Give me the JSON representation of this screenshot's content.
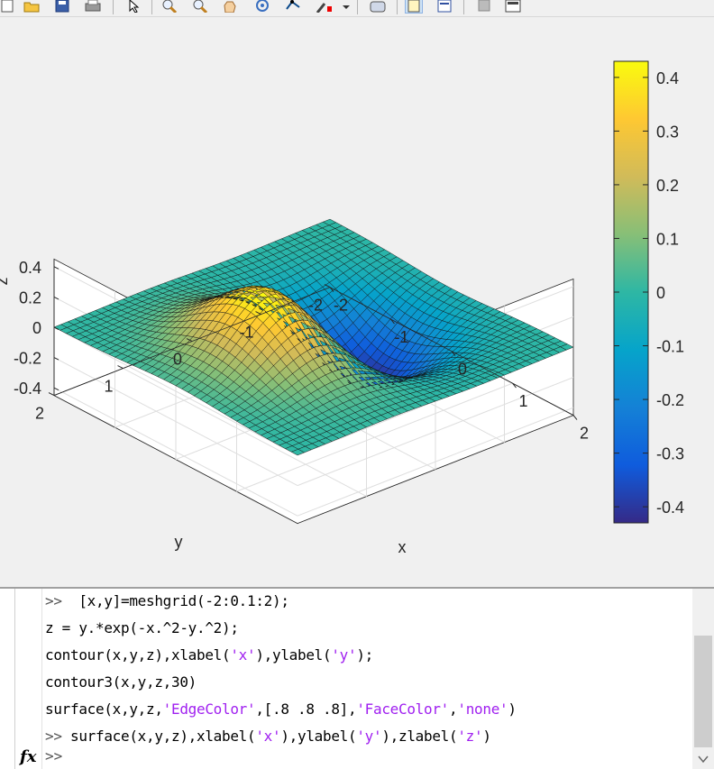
{
  "toolbar": {
    "buttons": [
      "new-figure-icon",
      "open-file-icon",
      "save-figure-icon",
      "print-figure-icon",
      "edit-plot-icon",
      "zoom-in-icon",
      "zoom-out-icon",
      "pan-icon",
      "rotate-3d-icon",
      "data-cursor-icon",
      "brush-icon",
      "link-plot-icon",
      "insert-colorbar-icon",
      "insert-legend-icon",
      "hide-plot-tools-icon",
      "show-plot-tools-icon"
    ]
  },
  "figure": {
    "zlabel": "z",
    "xlabel": "x",
    "ylabel": "y",
    "z_ticks": [
      "0.4",
      "0.2",
      "0",
      "-0.2",
      "-0.4"
    ],
    "x_ticks": [
      "-2",
      "-1",
      "0",
      "1",
      "2"
    ],
    "y_ticks": [
      "2",
      "1",
      "0",
      "-1",
      "-2"
    ],
    "colorbar_ticks": [
      "0.4",
      "0.3",
      "0.2",
      "0.1",
      "0",
      "-0.1",
      "-0.2",
      "-0.3",
      "-0.4"
    ],
    "colormap": "parula",
    "colors": {
      "low": "#352a87",
      "mid": "#21b1a4",
      "high": "#f9fb0e",
      "axes_bg": "#ffffff",
      "figure_bg": "#f0f0f0"
    }
  },
  "chart_data": {
    "type": "surface",
    "function": "z = y.*exp(-x.^2-y.^2)",
    "x_range": [
      -2,
      2
    ],
    "y_range": [
      -2,
      2
    ],
    "step": 0.1,
    "xlabel": "x",
    "ylabel": "y",
    "zlabel": "z",
    "zlim": [
      -0.45,
      0.45
    ],
    "clim": [
      -0.43,
      0.43
    ],
    "colormap": "parula",
    "grid": true,
    "colorbar": "right"
  },
  "command_window": {
    "lines": [
      [
        {
          "t": ">>  ",
          "c": "prompt"
        },
        {
          "t": "[x,y]=meshgrid(-2:0.1:2);"
        }
      ],
      [
        {
          "t": "z = y.*exp(-x.^2-y.^2);"
        }
      ],
      [
        {
          "t": "contour(x,y,z),xlabel("
        },
        {
          "t": "'x'",
          "c": "str"
        },
        {
          "t": "),ylabel("
        },
        {
          "t": "'y'",
          "c": "str"
        },
        {
          "t": ");"
        }
      ],
      [
        {
          "t": "contour3(x,y,z,30)"
        }
      ],
      [
        {
          "t": "surface(x,y,z,"
        },
        {
          "t": "'EdgeColor'",
          "c": "str"
        },
        {
          "t": ",[.8 .8 .8],"
        },
        {
          "t": "'FaceColor'",
          "c": "str"
        },
        {
          "t": ","
        },
        {
          "t": "'none'",
          "c": "str"
        },
        {
          "t": ")"
        }
      ],
      [
        {
          "t": ">> ",
          "c": "prompt"
        },
        {
          "t": "surface(x,y,z),xlabel("
        },
        {
          "t": "'x'",
          "c": "str"
        },
        {
          "t": "),ylabel("
        },
        {
          "t": "'y'",
          "c": "str"
        },
        {
          "t": "),zlabel("
        },
        {
          "t": "'z'",
          "c": "str"
        },
        {
          "t": ")"
        }
      ]
    ],
    "fx_label": "fx",
    "prompt": ">>"
  }
}
